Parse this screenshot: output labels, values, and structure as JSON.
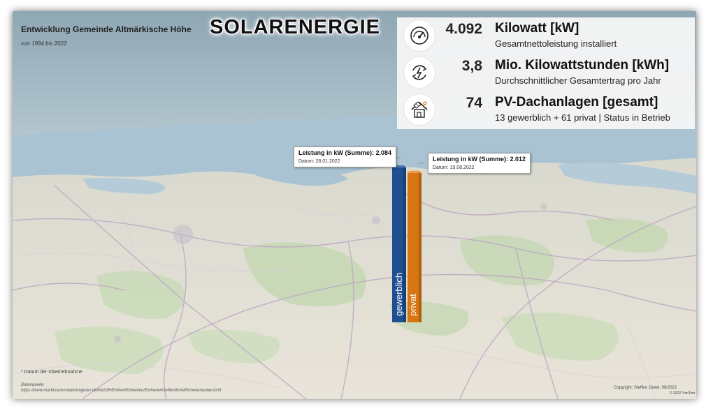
{
  "header": {
    "title": "Entwicklung Gemeinde Altmärkische Höhe",
    "subtitle": "von 1994 bis 2022",
    "banner": "SOLARENERGIE"
  },
  "kpis": [
    {
      "icon": "gauge-icon",
      "value": "4.092",
      "unit": "Kilowatt [kW]",
      "description": "Gesamtnettoleistung installiert"
    },
    {
      "icon": "energy-cycle-icon",
      "value": "3,8",
      "unit": "Mio. Kilowattstunden [kWh]",
      "description": "Durchschnittlicher Gesamtertrag pro Jahr"
    },
    {
      "icon": "solar-house-icon",
      "value": "74",
      "unit": "PV-Dachanlagen [gesamt]",
      "description": "13 gewerblich + 61 privat | Status in Betrieb"
    }
  ],
  "tooltips": [
    {
      "title": "Leistung in kW (Summe): 2.084",
      "date": "Datum: 28.01.2022"
    },
    {
      "title": "Leistung in kW (Summe): 2.012",
      "date": "Datum: 19.08.2022"
    }
  ],
  "chart_data": {
    "type": "bar",
    "categories": [
      "gewerblich",
      "privat"
    ],
    "values": [
      2084,
      2012
    ],
    "colors": [
      "#1f4f8f",
      "#d77511"
    ]
  },
  "footer": {
    "footnote": "* Datum der Inbetriebnahme",
    "source": "Datenquelle: https://www.marktstammdatenregister.de/MaStR/Einheit/Einheiten/EinheitenOeffentlicheEinheitenuebersicht",
    "copyright": "Copyright: Steffen Jüstel, 09/2022",
    "map_credit": "© 2022 TomTom"
  }
}
